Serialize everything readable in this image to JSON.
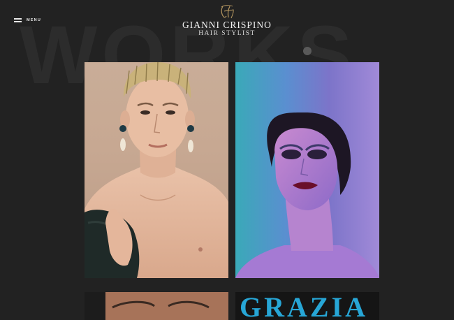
{
  "background_word": "WORKS",
  "menu": {
    "label": "MENU",
    "icon": "hamburger-icon"
  },
  "brand": {
    "monogram": "GC",
    "name": "GIANNI CRISPINO",
    "subtitle": "HAIR STYLIST"
  },
  "gallery": {
    "items": [
      {
        "subject": "portrait-man-slicked-blond-hair-pearl-earrings"
      },
      {
        "subject": "portrait-woman-dark-bob-dramatic-makeup-purple-backdrop"
      },
      {
        "subject": "portrait-face-closeup-partial"
      },
      {
        "subject": "magazine-cover-partial",
        "cover_text": "GRAZIA"
      }
    ]
  },
  "colors": {
    "page_background": "#222222",
    "accent_gold": "#b99a62",
    "text_primary": "#f2f2f2"
  }
}
